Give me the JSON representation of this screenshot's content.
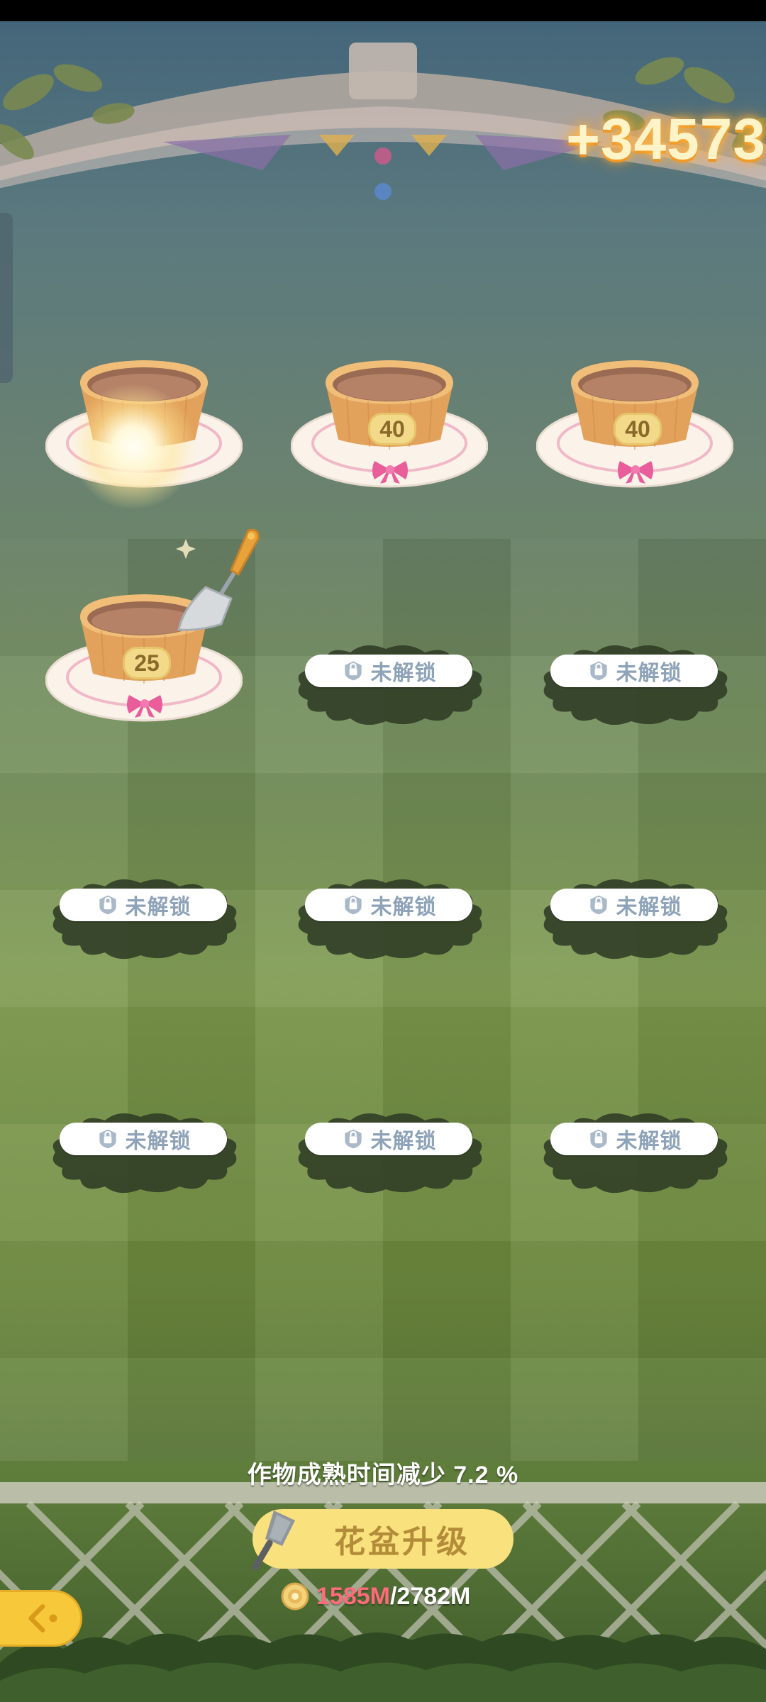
{
  "score_gain": "+34573",
  "pots": [
    {
      "id": 1,
      "level": "",
      "state": "planting"
    },
    {
      "id": 2,
      "level": "40",
      "state": "ready"
    },
    {
      "id": 3,
      "level": "40",
      "state": "ready"
    },
    {
      "id": 4,
      "level": "25",
      "state": "ready"
    }
  ],
  "locked_label": "未解锁",
  "bottom": {
    "info_text": "作物成熟时间减少 7.2 %",
    "upgrade_label": "花盆升级",
    "cost_current": "1585M",
    "cost_separator": "/",
    "cost_max": "2782M"
  },
  "colors": {
    "accent_yellow": "#f9e17d",
    "cost_current": "#ff6b7a",
    "locked_text": "#8ea3b8",
    "score_glow": "#ffb640"
  },
  "icons": {
    "back": "back-arrow-icon",
    "coin": "coin-icon",
    "trowel": "trowel-icon",
    "lock": "lock-icon",
    "bow": "bow-icon",
    "shovel": "shovel-icon"
  }
}
